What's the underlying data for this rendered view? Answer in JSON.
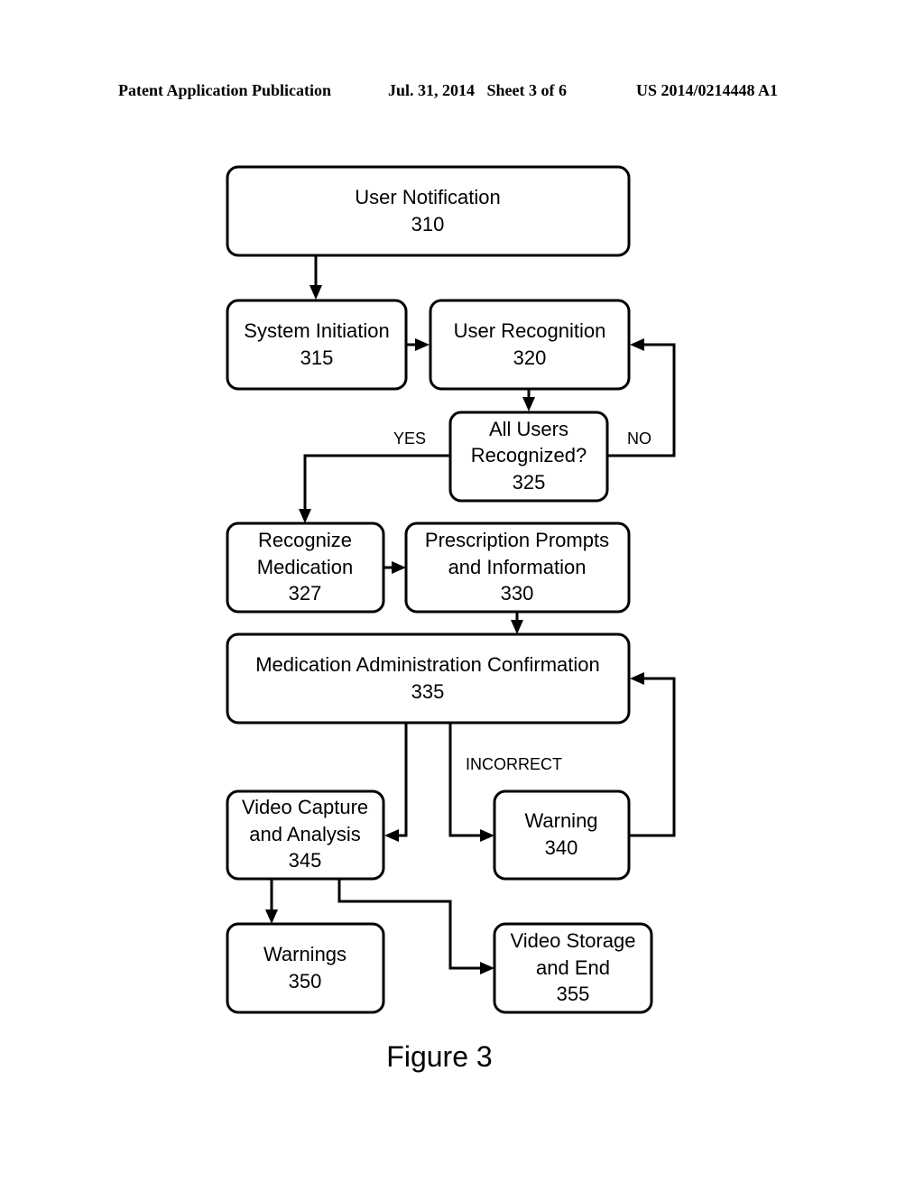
{
  "header": {
    "publication": "Patent Application Publication",
    "date_sheet": "Jul. 31, 2014   Sheet 3 of 6",
    "number": "US 2014/0214448 A1"
  },
  "nodes": {
    "n310": {
      "line1": "User Notification",
      "id": "310"
    },
    "n315": {
      "line1": "System Initiation",
      "id": "315"
    },
    "n320": {
      "line1": "User Recognition",
      "id": "320"
    },
    "n325": {
      "line1": "All Users",
      "line2": "Recognized?",
      "id": "325"
    },
    "n327": {
      "line1": "Recognize",
      "line2": "Medication",
      "id": "327"
    },
    "n330": {
      "line1": "Prescription Prompts",
      "line2": "and Information",
      "id": "330"
    },
    "n335": {
      "line1": "Medication Administration Confirmation",
      "id": "335"
    },
    "n340": {
      "line1": "Warning",
      "id": "340"
    },
    "n345": {
      "line1": "Video Capture",
      "line2": "and Analysis",
      "id": "345"
    },
    "n350": {
      "line1": "Warnings",
      "id": "350"
    },
    "n355": {
      "line1": "Video Storage",
      "line2": "and End",
      "id": "355"
    }
  },
  "edge_labels": {
    "yes": "YES",
    "no": "NO",
    "incorrect": "INCORRECT"
  },
  "figure_caption": "Figure 3"
}
